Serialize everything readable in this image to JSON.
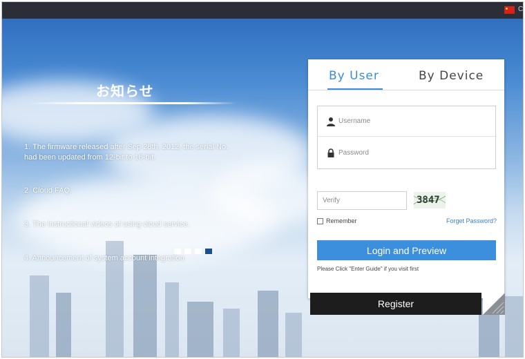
{
  "notice": {
    "title": "お知らせ",
    "items": [
      "1. The firmware released after Sep 28th, 2012, the serial No. had been updated from 12-bit to 16-bit.",
      "2. Cloud FAQ.",
      "3. The instructional videos of using cloud service.",
      "4. Announcement of system account integration"
    ],
    "active_slide": 4,
    "slide_count": 4
  },
  "login": {
    "tabs": [
      {
        "label": "By User",
        "active": true
      },
      {
        "label": "By Device",
        "active": false
      }
    ],
    "username_placeholder": "Username",
    "password_placeholder": "Password",
    "verify_placeholder": "Verify",
    "captcha": "3847",
    "remember_label": "Remember",
    "forgot_label": "Forget Password?",
    "login_button": "Login and Preview",
    "hint": "Please Click \"Enter Guide\" if you visit first",
    "register_button": "Register"
  },
  "colors": {
    "accent": "#3b8fdc",
    "topbar": "#2b2e36",
    "register_bg": "#1d1d1d"
  },
  "icons": {
    "language_flag": "china-flag-icon",
    "username": "user-icon",
    "password": "lock-icon",
    "corner": "page-corner-icon"
  }
}
